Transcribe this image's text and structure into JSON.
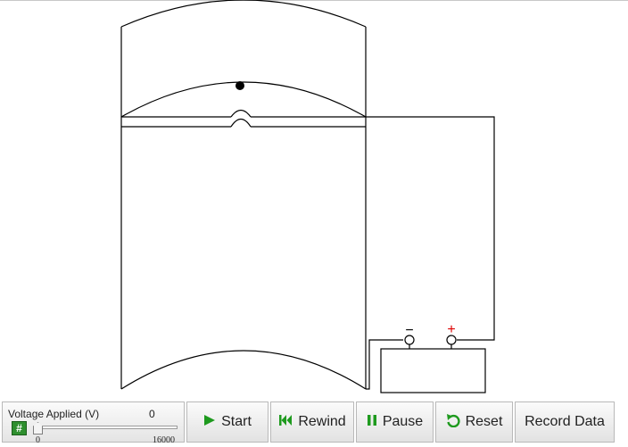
{
  "controls": {
    "voltage_label": "Voltage Applied (V)",
    "voltage_value": "0",
    "voltage_fraction": 0.0,
    "slider_min": "0",
    "slider_max": "16000",
    "number_button_glyph": "#",
    "start_label": "Start",
    "rewind_label": "Rewind",
    "pause_label": "Pause",
    "reset_label": "Reset",
    "record_label": "Record Data"
  },
  "diagram": {
    "negative_terminal": "−",
    "positive_terminal": "+",
    "positive_color": "#dd0000",
    "negative_color": "#000000"
  },
  "icons": {
    "start": "play-icon",
    "rewind": "rewind-icon",
    "pause": "pause-icon",
    "reset": "reset-icon",
    "number_input": "hash-icon"
  },
  "colors": {
    "accent_green": "#1e9a1e"
  }
}
